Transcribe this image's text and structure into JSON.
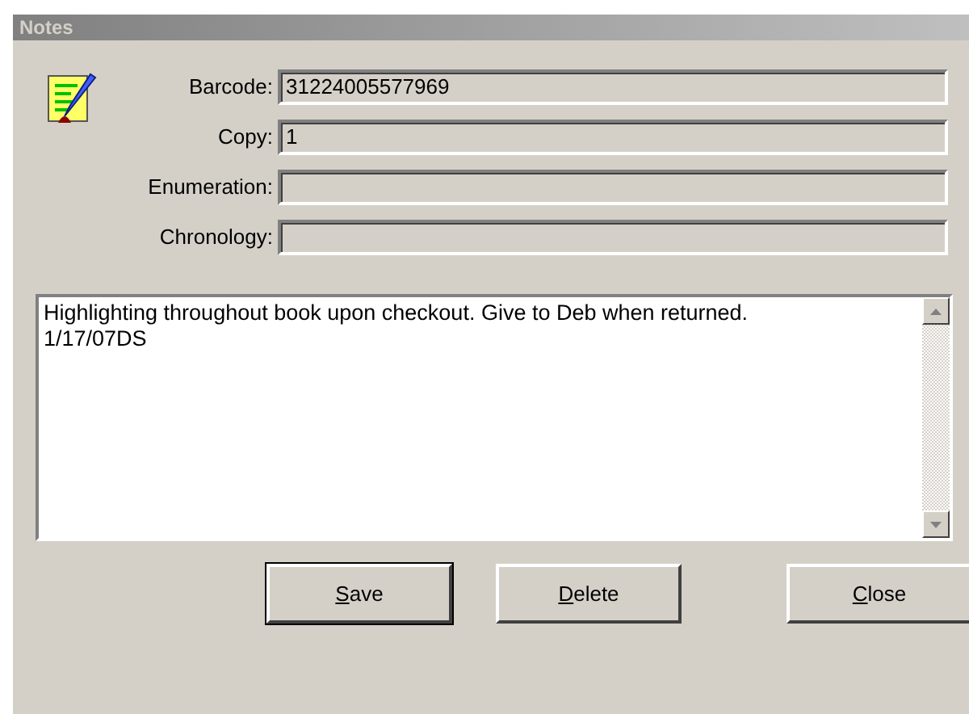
{
  "window": {
    "title": "Notes"
  },
  "fields": [
    {
      "label": "Barcode:",
      "value": "31224005577969"
    },
    {
      "label": "Copy:",
      "value": "1"
    },
    {
      "label": "Enumeration:"
    },
    {
      "label": "Chronology:"
    }
  ],
  "note": {
    "text": "Highlighting throughout book upon checkout. Give to Deb when returned. 1/17/07DS"
  },
  "buttons": [
    {
      "label": "Save",
      "default": true
    },
    {
      "label": "Delete",
      "default": false
    },
    {
      "label": "Close",
      "default": false
    }
  ]
}
